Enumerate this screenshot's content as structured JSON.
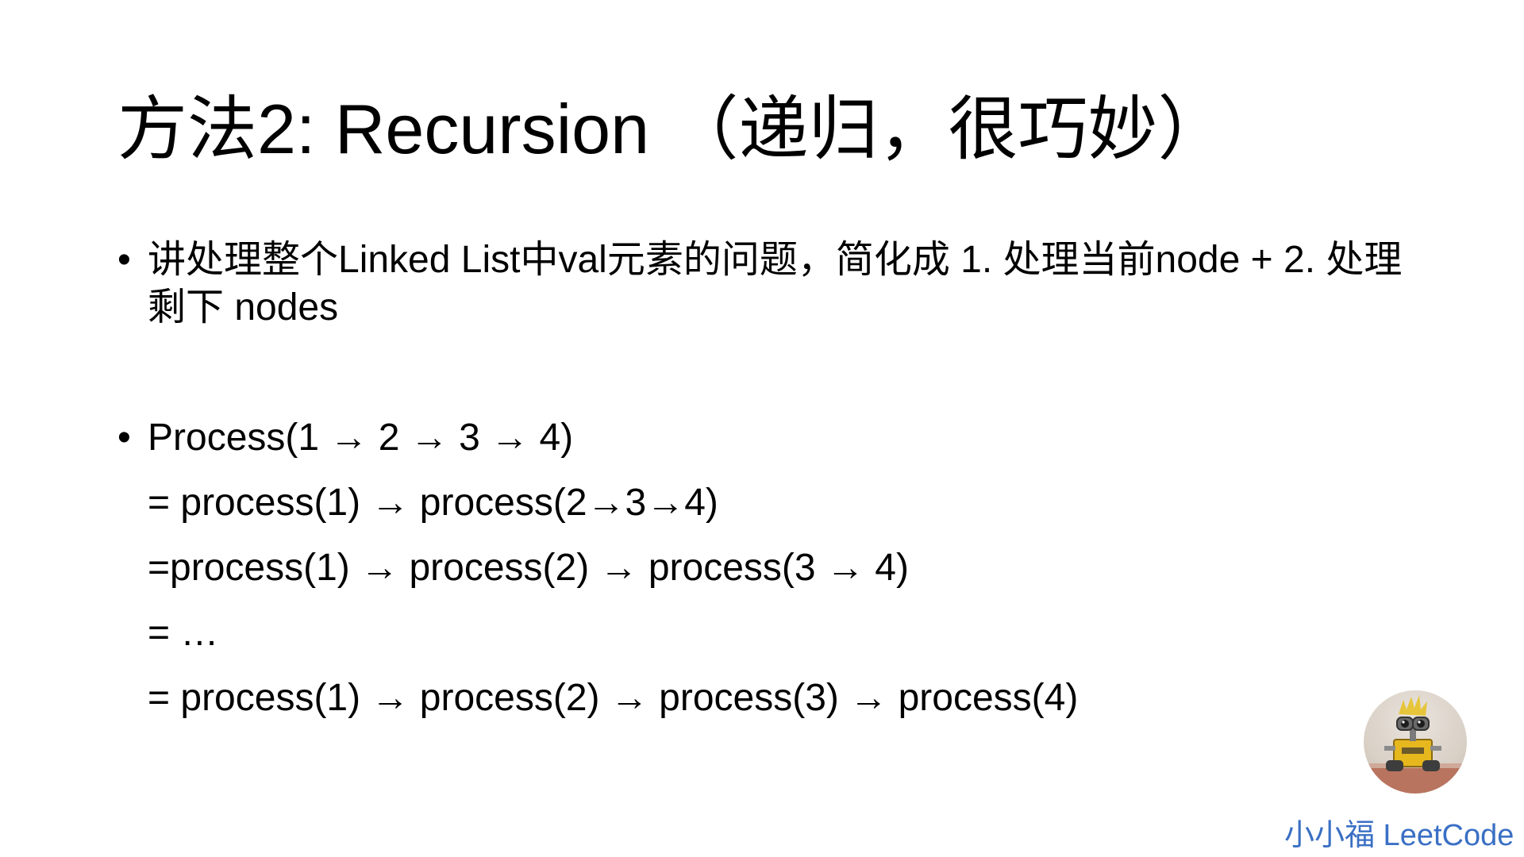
{
  "slide": {
    "title": "方法2: Recursion （递归，很巧妙）",
    "bullet_symbol": "•",
    "bullets": [
      {
        "text": "讲处理整个Linked List中val元素的问题，简化成 1. 处理当前node + 2. 处理剩下 nodes"
      },
      {
        "text": "Process(1 → 2 → 3 → 4)"
      }
    ],
    "continuation_lines": [
      "= process(1) → process(2→3→4)",
      "=process(1) → process(2) → process(3 → 4)",
      "= …",
      "= process(1) → process(2) → process(3) → process(4)"
    ]
  },
  "branding": {
    "label": "小小福 LeetCode",
    "color": "#3a6fc4",
    "avatar_icon": "robot-avatar-icon"
  }
}
